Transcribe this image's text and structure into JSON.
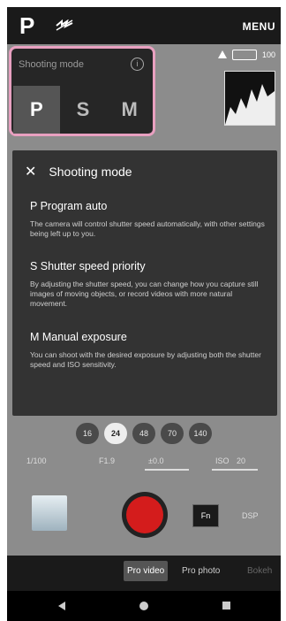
{
  "topbar": {
    "mode_letter": "P",
    "flash_icon": "flash-off-icon",
    "menu_label": "MENU"
  },
  "status": {
    "warning_icon": "alert-icon",
    "battery_icon": "battery-icon",
    "battery_text": "100"
  },
  "shooting_panel": {
    "title": "Shooting mode",
    "info_icon": "info-icon",
    "modes": [
      {
        "label": "P",
        "active": true
      },
      {
        "label": "S",
        "active": false
      },
      {
        "label": "M",
        "active": false
      }
    ]
  },
  "help": {
    "title": "Shooting mode",
    "sections": [
      {
        "heading": "P Program auto",
        "body": "The camera will control shutter speed automatically, with other settings being left up to you."
      },
      {
        "heading": "S Shutter speed priority",
        "body": "By adjusting the shutter speed, you can change how you capture still images of moving objects, or record videos with more natural movement."
      },
      {
        "heading": "M Manual exposure",
        "body": "You can shoot with the desired exposure by adjusting both the shutter speed and ISO sensitivity."
      }
    ]
  },
  "fps": {
    "options": [
      "16",
      "24",
      "48",
      "70",
      "140"
    ],
    "selected": "24"
  },
  "params": {
    "shutter": "1/100",
    "aperture": "F1.9",
    "ev": "±0.0",
    "iso_label": "ISO",
    "iso_value": "20"
  },
  "controls": {
    "fn_label": "Fn",
    "dsp_label": "DSP"
  },
  "bottom_tabs": {
    "tabs": [
      "Pro video",
      "Pro photo",
      "Bokeh"
    ],
    "selected": "Pro video"
  },
  "colors": {
    "shutter_red": "#d41c1c",
    "highlight_pink": "#e8a0c0"
  }
}
